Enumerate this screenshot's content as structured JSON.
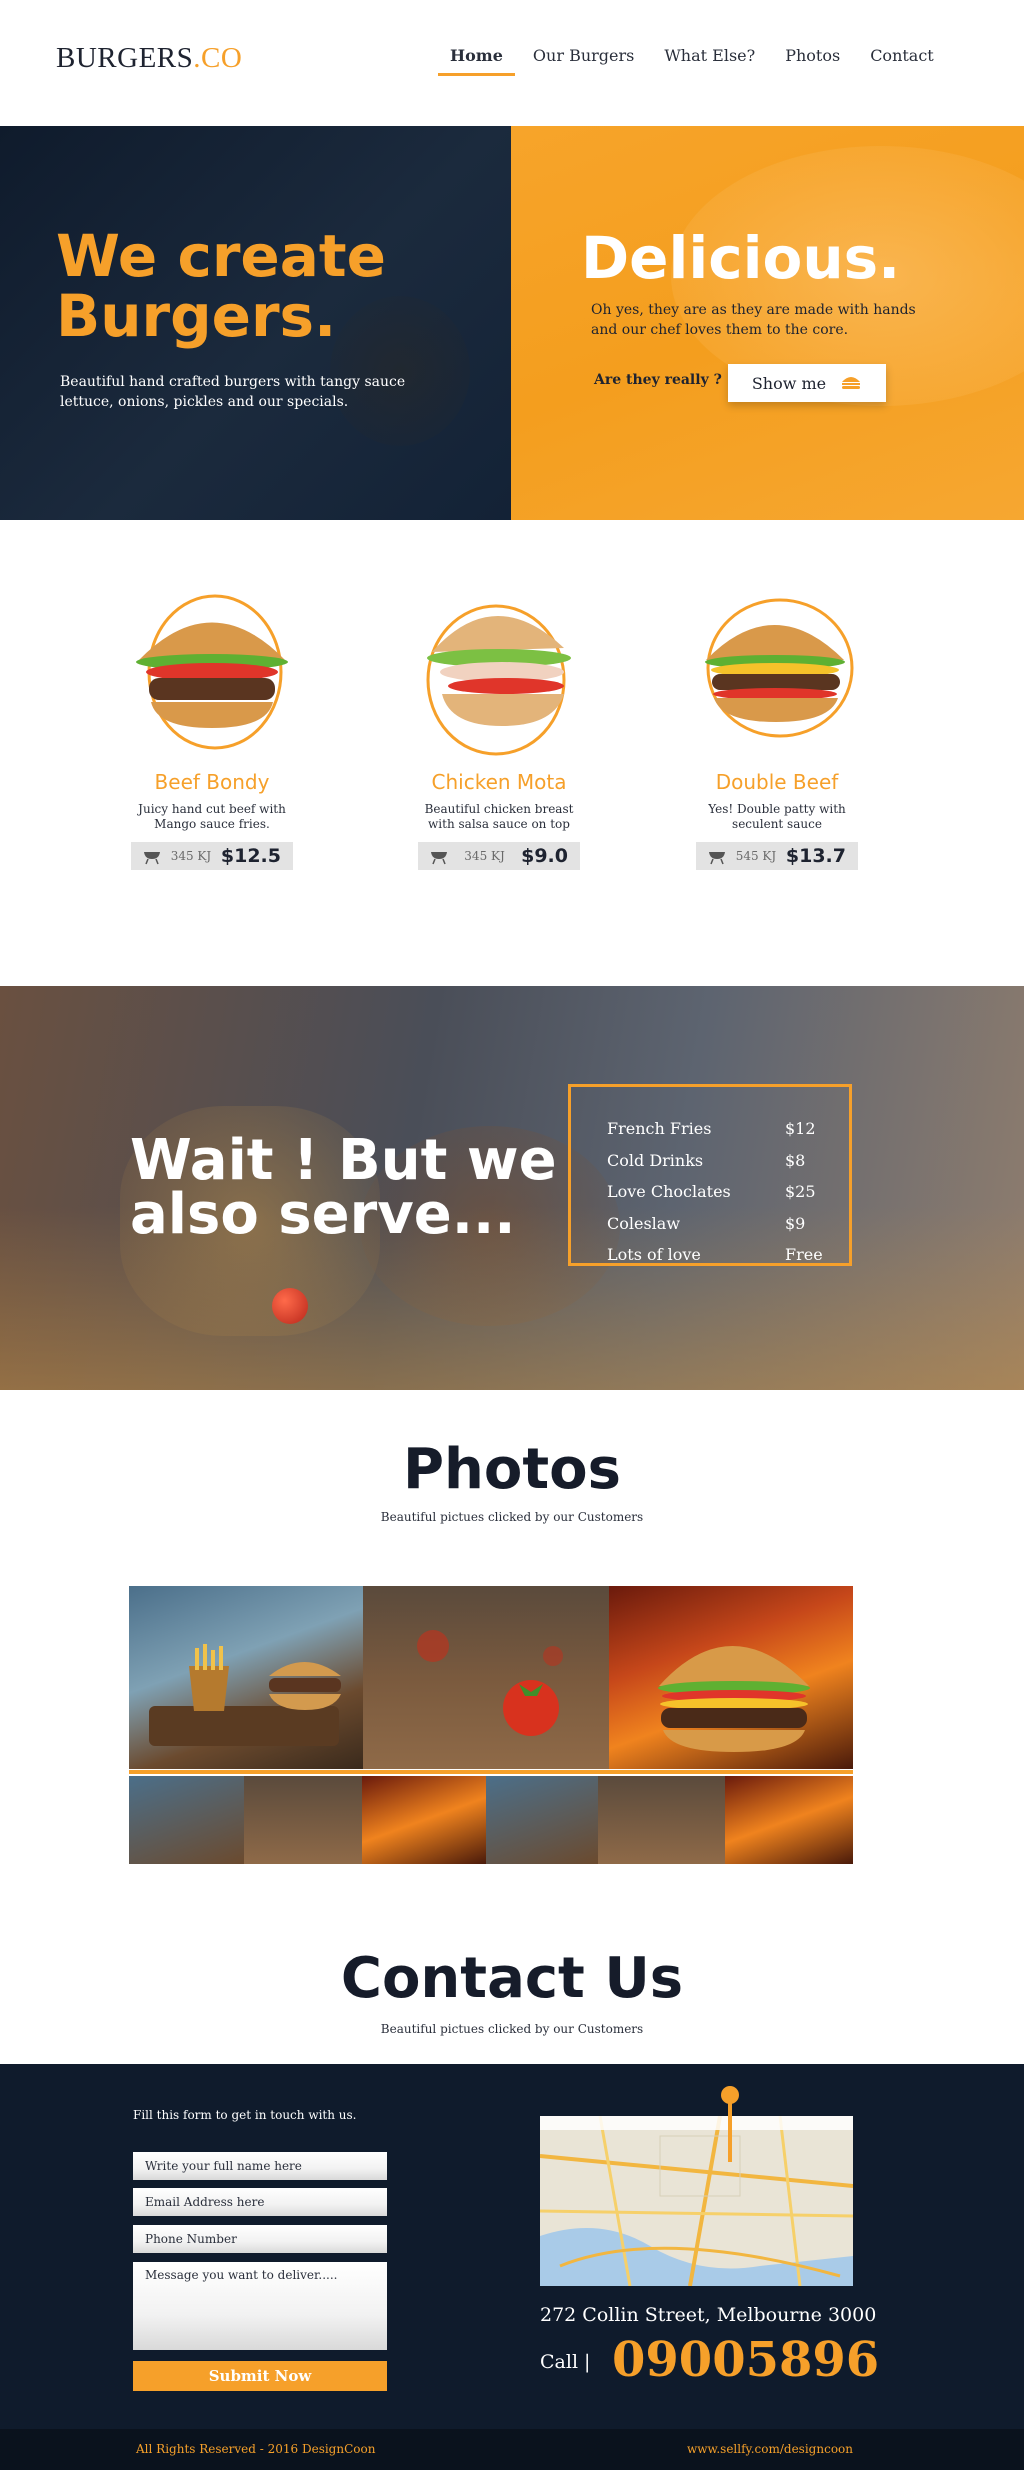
{
  "header": {
    "logo_brand": "BURGERS",
    "logo_dot": ".",
    "logo_tld": "CO",
    "nav": [
      "Home",
      "Our Burgers",
      "What Else?",
      "Photos",
      "Contact"
    ]
  },
  "hero": {
    "title_line1": "We create",
    "title_line2": "Burgers.",
    "subtitle": "Beautiful hand crafted burgers with tangy sauce lettuce, onions, pickles and our specials.",
    "right_title": "Delicious.",
    "right_text": "Oh yes, they are as they are made with hands and our chef loves them to the core.",
    "question": "Are they really ?",
    "button_label": "Show me"
  },
  "burgers": [
    {
      "name": "Beef Bondy",
      "desc": "Juicy hand cut beef with Mango sauce fries.",
      "kj": "345 KJ",
      "price": "$12.5"
    },
    {
      "name": "Chicken Mota",
      "desc": "Beautiful chicken breast with salsa sauce on top",
      "kj": "345 KJ",
      "price": "$9.0"
    },
    {
      "name": "Double Beef",
      "desc": "Yes! Double patty with seculent sauce",
      "kj": "545 KJ",
      "price": "$13.7"
    }
  ],
  "serve": {
    "title_line1": "Wait ! But we",
    "title_line2": "also serve...",
    "items": [
      {
        "name": "French Fries",
        "price": "$12"
      },
      {
        "name": "Cold Drinks",
        "price": "$8"
      },
      {
        "name": "Love Choclates",
        "price": "$25"
      },
      {
        "name": "Coleslaw",
        "price": "$9"
      },
      {
        "name": "Lots of love",
        "price": "Free"
      }
    ]
  },
  "photos": {
    "title": "Photos",
    "subtitle": "Beautiful pictues clicked by our Customers"
  },
  "contact": {
    "title": "Contact Us",
    "subtitle": "Beautiful pictues clicked by our Customers",
    "form_intro": "Fill this form to get in touch with us.",
    "name_placeholder": "Write your full name here",
    "email_placeholder": "Email Address here",
    "phone_placeholder": "Phone Number",
    "message_placeholder": "Message you want to deliver.....",
    "submit_label": "Submit Now",
    "address": "272 Collin Street, Melbourne 3000",
    "call_label": "Call  |",
    "phone": "09005896"
  },
  "footer": {
    "copyright": "All Rights Reserved - 2016 DesignCoon",
    "website": "www.sellfy.com/designcoon"
  },
  "colors": {
    "accent": "#f6a02a",
    "navy": "#0f1b2c"
  }
}
